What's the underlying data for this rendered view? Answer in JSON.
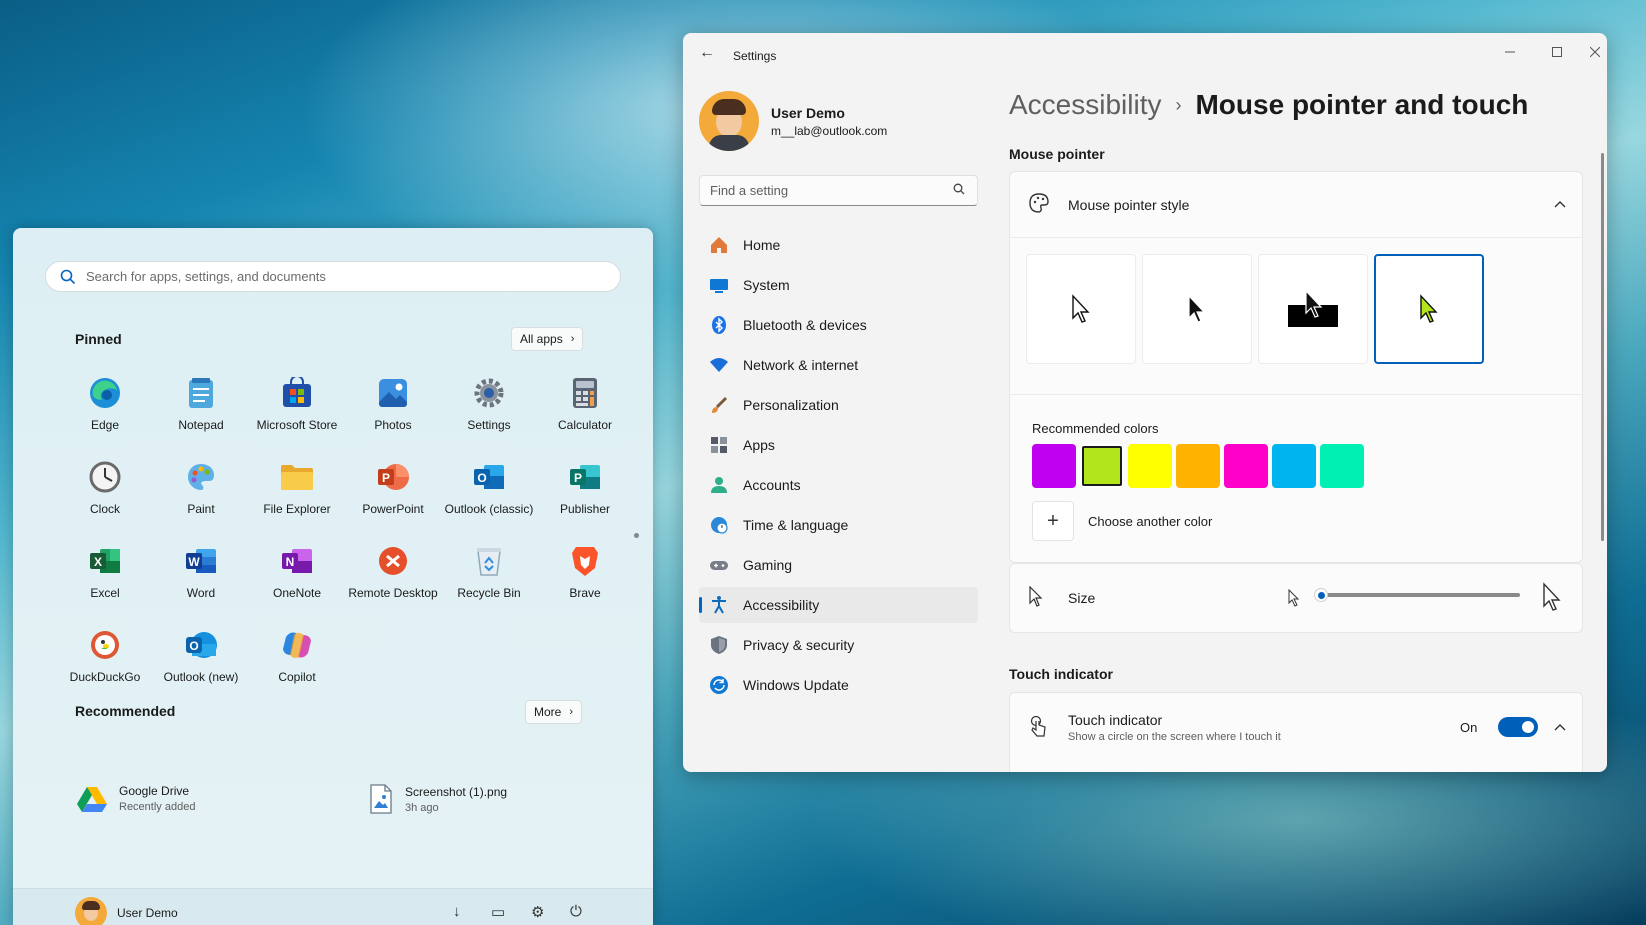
{
  "start_menu": {
    "search_placeholder": "Search for apps, settings, and documents",
    "pinned_title": "Pinned",
    "all_apps_label": "All apps",
    "pinned_apps": [
      {
        "label": "Edge",
        "icon": "edge-icon"
      },
      {
        "label": "Notepad",
        "icon": "notepad-icon"
      },
      {
        "label": "Microsoft Store",
        "icon": "microsoft-store-icon"
      },
      {
        "label": "Photos",
        "icon": "photos-icon"
      },
      {
        "label": "Settings",
        "icon": "settings-gear-icon"
      },
      {
        "label": "Calculator",
        "icon": "calculator-icon"
      },
      {
        "label": "Clock",
        "icon": "clock-icon"
      },
      {
        "label": "Paint",
        "icon": "paint-icon"
      },
      {
        "label": "File Explorer",
        "icon": "file-explorer-icon"
      },
      {
        "label": "PowerPoint",
        "icon": "powerpoint-icon"
      },
      {
        "label": "Outlook (classic)",
        "icon": "outlook-classic-icon"
      },
      {
        "label": "Publisher",
        "icon": "publisher-icon"
      },
      {
        "label": "Excel",
        "icon": "excel-icon"
      },
      {
        "label": "Word",
        "icon": "word-icon"
      },
      {
        "label": "OneNote",
        "icon": "onenote-icon"
      },
      {
        "label": "Remote Desktop",
        "icon": "remote-desktop-icon"
      },
      {
        "label": "Recycle Bin",
        "icon": "recycle-bin-icon"
      },
      {
        "label": "Brave",
        "icon": "brave-icon"
      },
      {
        "label": "DuckDuckGo",
        "icon": "duckduckgo-icon"
      },
      {
        "label": "Outlook (new)",
        "icon": "outlook-new-icon"
      },
      {
        "label": "Copilot",
        "icon": "copilot-icon"
      }
    ],
    "recommended_title": "Recommended",
    "more_label": "More",
    "recommended": [
      {
        "title": "Google Drive",
        "subtitle": "Recently added",
        "icon": "google-drive-icon"
      },
      {
        "title": "Screenshot (1).png",
        "subtitle": "3h ago",
        "icon": "image-file-icon"
      }
    ],
    "footer": {
      "user_name": "User Demo"
    }
  },
  "settings": {
    "window_title": "Settings",
    "user": {
      "name": "User Demo",
      "email": "m__lab@outlook.com"
    },
    "search_placeholder": "Find a setting",
    "nav": [
      {
        "label": "Home",
        "icon": "home-icon",
        "color": "#e07a3a"
      },
      {
        "label": "System",
        "icon": "monitor-icon",
        "color": "#0f78d4"
      },
      {
        "label": "Bluetooth & devices",
        "icon": "bluetooth-icon",
        "color": "#1a73e8"
      },
      {
        "label": "Network & internet",
        "icon": "wifi-icon",
        "color": "#1a6ed8"
      },
      {
        "label": "Personalization",
        "icon": "brush-icon",
        "color": "#d08040"
      },
      {
        "label": "Apps",
        "icon": "apps-icon",
        "color": "#555a66"
      },
      {
        "label": "Accounts",
        "icon": "person-icon",
        "color": "#2eaf8a"
      },
      {
        "label": "Time & language",
        "icon": "globe-clock-icon",
        "color": "#2b88d8"
      },
      {
        "label": "Gaming",
        "icon": "gamepad-icon",
        "color": "#777c88"
      },
      {
        "label": "Accessibility",
        "icon": "accessibility-icon",
        "color": "#0f6cbd"
      },
      {
        "label": "Privacy & security",
        "icon": "shield-icon",
        "color": "#6b7280"
      },
      {
        "label": "Windows Update",
        "icon": "update-icon",
        "color": "#0f78d4"
      }
    ],
    "active_nav": "Accessibility",
    "breadcrumb": {
      "parent": "Accessibility",
      "current": "Mouse pointer and touch"
    },
    "mouse_pointer": {
      "section_title": "Mouse pointer",
      "style_label": "Mouse pointer style",
      "styles": [
        "white",
        "black",
        "inverted",
        "custom"
      ],
      "selected_style": "custom",
      "recommended_colors_label": "Recommended colors",
      "colors": [
        "#c000f0",
        "#b2e61a",
        "#ffff00",
        "#ffb300",
        "#ff00c8",
        "#00b4f0",
        "#00f0b4"
      ],
      "selected_color": "#b2e61a",
      "choose_color_label": "Choose another color",
      "size_label": "Size",
      "size_value": 1
    },
    "touch": {
      "section_title": "Touch indicator",
      "label": "Touch indicator",
      "description": "Show a circle on the screen where I touch it",
      "state_label": "On"
    }
  }
}
